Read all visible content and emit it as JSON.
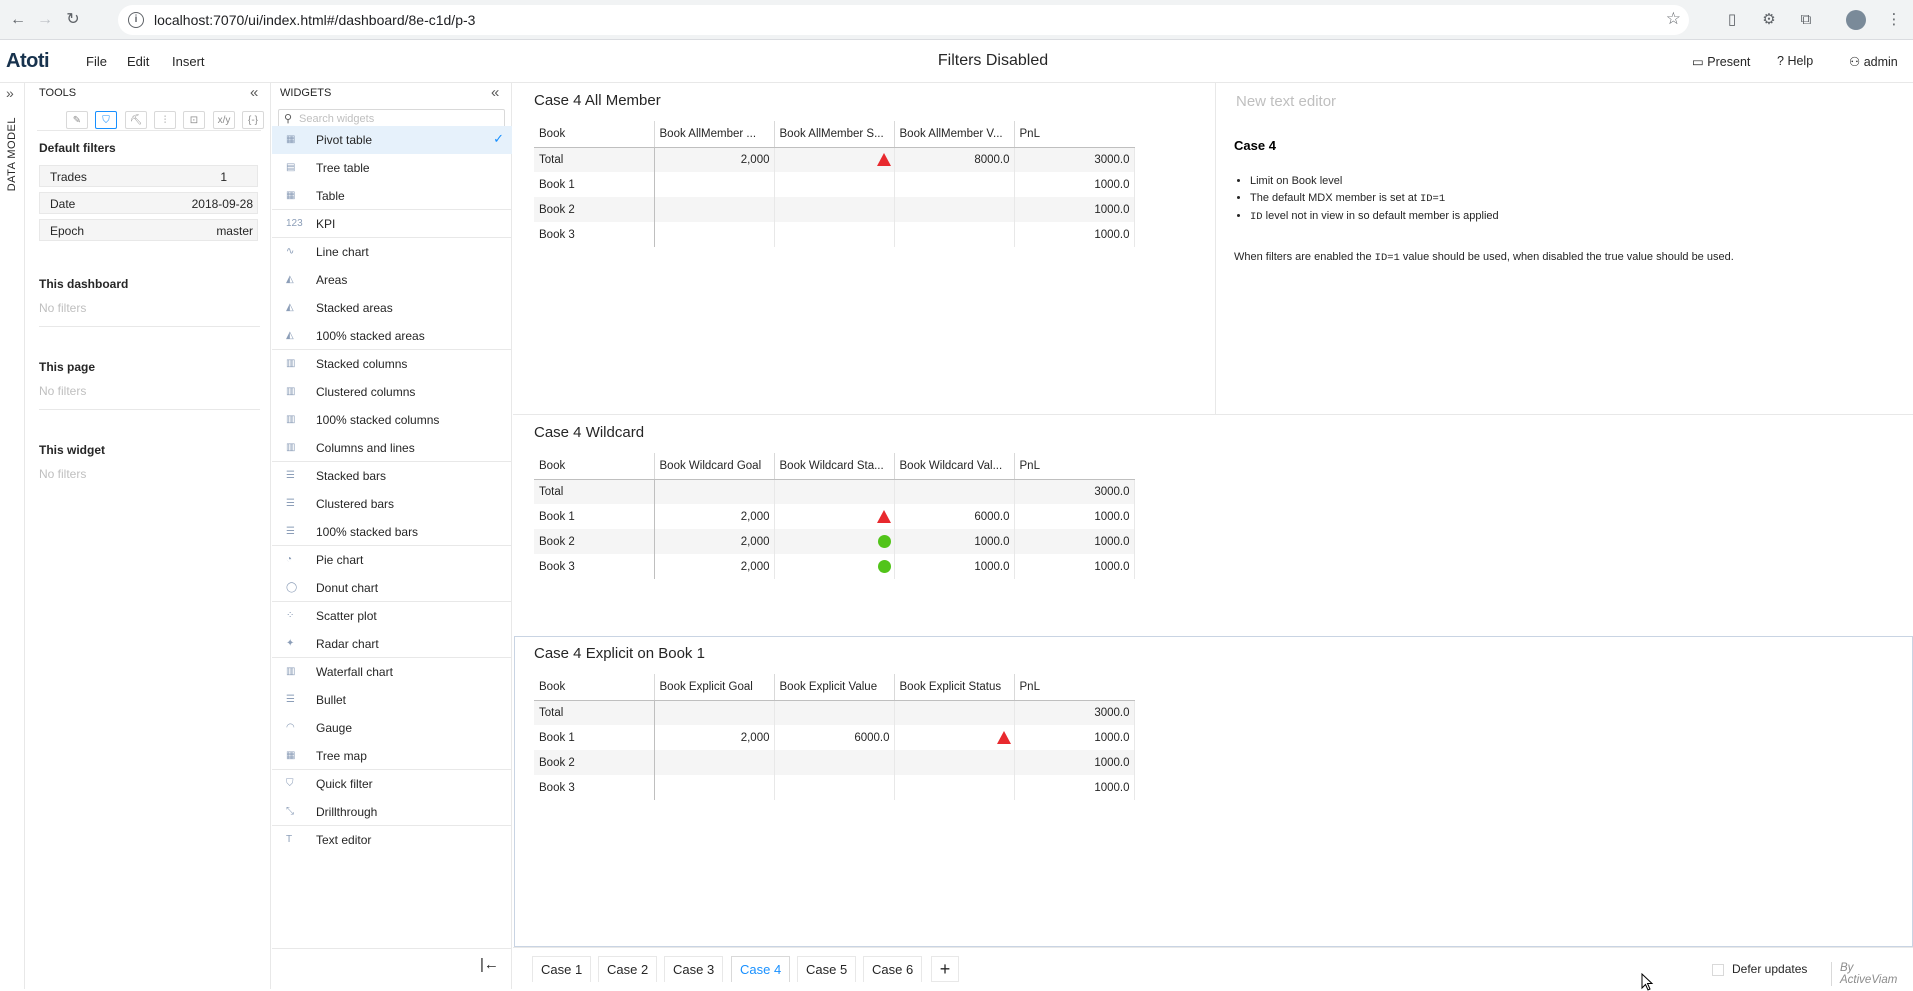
{
  "browser": {
    "url": "localhost:7070/ui/index.html#/dashboard/8e-c1d/p-3",
    "info_icon": "i"
  },
  "app": {
    "logo": "Atoti",
    "menu": [
      "File",
      "Edit",
      "Insert"
    ],
    "dashboard_title": "Filters Disabled",
    "present_label": "Present",
    "help_label": "Help",
    "user_label": "admin"
  },
  "rail": {
    "label": "DATA MODEL"
  },
  "tools": {
    "title": "TOOLS",
    "tabs": [
      "pencil-icon",
      "filter-icon",
      "paint-roller-icon",
      "sliders-icon",
      "formula-icon",
      "xy-icon",
      "braces-icon"
    ],
    "tab_glyphs": [
      "✎",
      "⛉",
      "⛏",
      "⫶",
      "⊡",
      "x/y",
      "{-}"
    ],
    "default_filters_title": "Default filters",
    "default_filters": [
      {
        "key": "Trades",
        "value": "1"
      },
      {
        "key": "Date",
        "value": "2018-09-28"
      },
      {
        "key": "Epoch",
        "value": "master"
      }
    ],
    "this_dashboard": "This dashboard",
    "this_page": "This page",
    "this_widget": "This widget",
    "no_filters": "No filters"
  },
  "widgets": {
    "title": "WIDGETS",
    "search_placeholder": "Search widgets",
    "items": [
      {
        "label": "Pivot table",
        "glyph": "▦"
      },
      {
        "label": "Tree table",
        "glyph": "▤"
      },
      {
        "label": "Table",
        "glyph": "▦"
      },
      {
        "label": "KPI",
        "glyph": "123"
      },
      {
        "label": "Line chart",
        "glyph": "∿"
      },
      {
        "label": "Areas",
        "glyph": "◭"
      },
      {
        "label": "Stacked areas",
        "glyph": "◭"
      },
      {
        "label": "100% stacked areas",
        "glyph": "◭"
      },
      {
        "label": "Stacked columns",
        "glyph": "▥"
      },
      {
        "label": "Clustered columns",
        "glyph": "▥"
      },
      {
        "label": "100% stacked columns",
        "glyph": "▥"
      },
      {
        "label": "Columns and lines",
        "glyph": "▥"
      },
      {
        "label": "Stacked bars",
        "glyph": "☰"
      },
      {
        "label": "Clustered bars",
        "glyph": "☰"
      },
      {
        "label": "100% stacked bars",
        "glyph": "☰"
      },
      {
        "label": "Pie chart",
        "glyph": "◔"
      },
      {
        "label": "Donut chart",
        "glyph": "◯"
      },
      {
        "label": "Scatter plot",
        "glyph": "⁘"
      },
      {
        "label": "Radar chart",
        "glyph": "✦"
      },
      {
        "label": "Waterfall chart",
        "glyph": "▥"
      },
      {
        "label": "Bullet",
        "glyph": "☰"
      },
      {
        "label": "Gauge",
        "glyph": "◠"
      },
      {
        "label": "Tree map",
        "glyph": "▦"
      },
      {
        "label": "Quick filter",
        "glyph": "⛉"
      },
      {
        "label": "Drillthrough",
        "glyph": "⤡"
      },
      {
        "label": "Text editor",
        "glyph": "T"
      }
    ]
  },
  "tables": [
    {
      "title": "Case 4 All Member",
      "headers": [
        "Book",
        "Book AllMember ...",
        "Book AllMember S...",
        "Book AllMember V...",
        "PnL"
      ],
      "rows": [
        [
          "Total",
          "2,000",
          "tri",
          "8000.0",
          "3000.0"
        ],
        [
          "Book 1",
          "",
          "",
          "",
          "1000.0"
        ],
        [
          "Book 2",
          "",
          "",
          "",
          "1000.0"
        ],
        [
          "Book 3",
          "",
          "",
          "",
          "1000.0"
        ]
      ]
    },
    {
      "title": "Case 4 Wildcard",
      "headers": [
        "Book",
        "Book Wildcard Goal",
        "Book Wildcard Sta...",
        "Book Wildcard Val...",
        "PnL"
      ],
      "rows": [
        [
          "Total",
          "",
          "",
          "",
          "3000.0"
        ],
        [
          "Book 1",
          "2,000",
          "tri",
          "6000.0",
          "1000.0"
        ],
        [
          "Book 2",
          "2,000",
          "dot",
          "1000.0",
          "1000.0"
        ],
        [
          "Book 3",
          "2,000",
          "dot",
          "1000.0",
          "1000.0"
        ]
      ]
    },
    {
      "title": "Case 4 Explicit on Book 1",
      "headers": [
        "Book",
        "Book Explicit Goal",
        "Book Explicit Value",
        "Book Explicit Status",
        "PnL"
      ],
      "rows": [
        [
          "Total",
          "",
          "",
          "",
          "3000.0"
        ],
        [
          "Book 1",
          "2,000",
          "6000.0",
          "tri",
          "1000.0"
        ],
        [
          "Book 2",
          "",
          "",
          "",
          "1000.0"
        ],
        [
          "Book 3",
          "",
          "",
          "",
          "1000.0"
        ]
      ]
    }
  ],
  "text_editor": {
    "placeholder": "New text editor",
    "heading": "Case 4",
    "bullet1": "Limit on Book level",
    "bullet2_pre": "The default MDX member is set at ",
    "bullet2_code": "ID=1",
    "bullet3_code": "ID",
    "bullet3_post": " level not in view in so default member is applied",
    "para_pre": "When filters are enabled the ",
    "para_code": "ID=1",
    "para_post": " value should be used, when disabled the true value should be used."
  },
  "footer": {
    "tabs": [
      "Case 1",
      "Case 2",
      "Case 3",
      "Case 4",
      "Case 5",
      "Case 6"
    ],
    "active_tab": "Case 4",
    "add_label": "+",
    "defer_label": "Defer updates",
    "by_label": "By ActiveViam"
  },
  "colors": {
    "accent": "#1890ff",
    "red": "#e8292e",
    "green": "#52c41a"
  }
}
